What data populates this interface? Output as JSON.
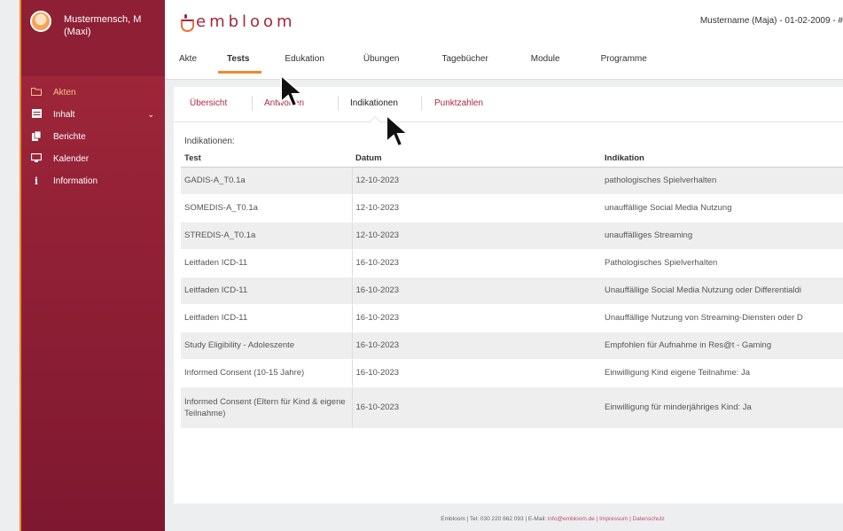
{
  "user": {
    "name": "Mustermensch, M (Maxi)"
  },
  "sidebar": {
    "items": [
      {
        "label": "Akten",
        "icon": "folder-icon",
        "active": true
      },
      {
        "label": "Inhalt",
        "icon": "content-icon",
        "chevron": true
      },
      {
        "label": "Berichte",
        "icon": "reports-icon"
      },
      {
        "label": "Kalender",
        "icon": "calendar-icon"
      },
      {
        "label": "Information",
        "icon": "info-icon"
      }
    ]
  },
  "header": {
    "brand": "embloom",
    "patient": "Mustername (Maja) - 01-02-2009 - #",
    "tabs": [
      "Akte",
      "Tests",
      "Edukation",
      "Übungen",
      "Tagebücher",
      "Module",
      "Programme"
    ],
    "active_tab": "Tests"
  },
  "subtabs": {
    "items": [
      "Übersicht",
      "Antworten",
      "Indikationen",
      "Punktzahlen"
    ],
    "active": "Indikationen"
  },
  "indications": {
    "label": "Indikationen:",
    "columns": [
      "Test",
      "Datum",
      "Indikation"
    ],
    "rows": [
      [
        "GADIS-A_T0.1a",
        "12-10-2023",
        "pathologisches Spielverhalten"
      ],
      [
        "SOMEDIS-A_T0.1a",
        "12-10-2023",
        "unauffällige Social Media Nutzung"
      ],
      [
        "STREDIS-A_T0.1a",
        "12-10-2023",
        "unauffälliges Streaming"
      ],
      [
        "Leitfaden ICD-11",
        "16-10-2023",
        "Pathologisches Spielverhalten"
      ],
      [
        "Leitfaden ICD-11",
        "16-10-2023",
        "Unauffällige Social Media Nutzung oder Differentialdi"
      ],
      [
        "Leitfaden ICD-11",
        "16-10-2023",
        "Unauffällige Nutzung von Streaming-Diensten oder D"
      ],
      [
        "Study Eligibility - Adoleszente",
        "16-10-2023",
        "Empfohlen für Aufnahme in Res@t - Gaming"
      ],
      [
        "Informed Consent (10-15 Jahre)",
        "16-10-2023",
        "Einwilligung Kind eigene Teilnahme: Ja"
      ],
      [
        "Informed Consent (Eltern für Kind & eigene Teilnahme)",
        "16-10-2023",
        "Einwilligung für minderjähriges Kind: Ja"
      ]
    ]
  },
  "footer": {
    "text": "Embloom | Tel: 030 220 662 093 | E-Mail: ",
    "links": "info@embloom.de | Impressum | Datenschutz"
  },
  "colors": {
    "accent": "#f08a2c",
    "brand": "#a3283b",
    "link": "#b02845"
  }
}
